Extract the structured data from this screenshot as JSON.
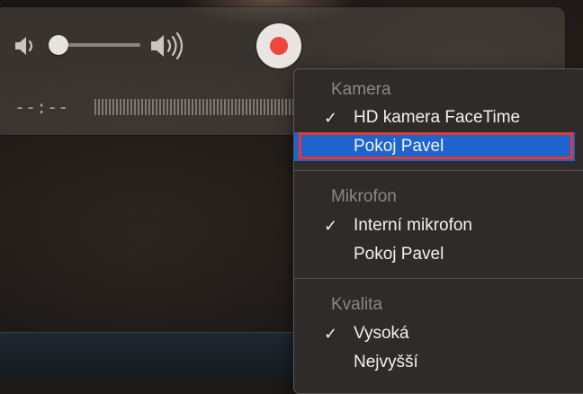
{
  "player": {
    "time_display": "--:--"
  },
  "menu": {
    "sections": [
      {
        "header": "Kamera",
        "items": [
          {
            "label": "HD kamera FaceTime",
            "checked": true
          },
          {
            "label": "Pokoj Pavel",
            "checked": false,
            "highlighted": true
          }
        ]
      },
      {
        "header": "Mikrofon",
        "items": [
          {
            "label": "Interní mikrofon",
            "checked": true
          },
          {
            "label": "Pokoj Pavel",
            "checked": false
          }
        ]
      },
      {
        "header": "Kvalita",
        "items": [
          {
            "label": "Vysoká",
            "checked": true
          },
          {
            "label": "Nejvyšší",
            "checked": false
          }
        ]
      }
    ],
    "check_glyph": "✓"
  },
  "colors": {
    "record": "#f0463e",
    "selection": "#1e64cf",
    "annotation": "#e23a2e"
  },
  "icons": [
    "volume-low-icon",
    "volume-high-icon",
    "record-icon",
    "checkmark-icon"
  ],
  "volume_level": 0.05
}
